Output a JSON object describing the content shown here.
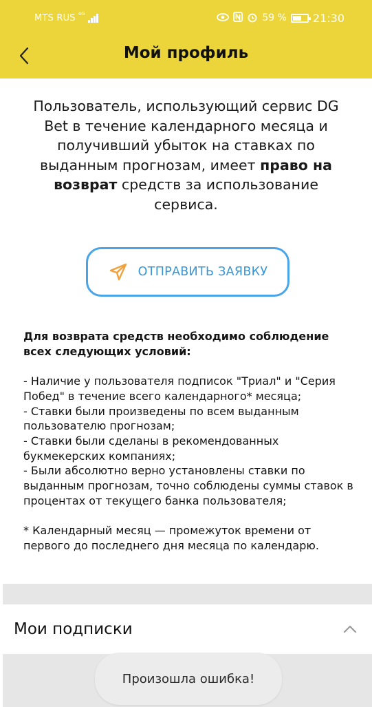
{
  "status_bar": {
    "carrier": "MTS RUS",
    "network_type": "4G",
    "battery_percent": "59 %",
    "time": "21:30",
    "icons": [
      "signal-icon",
      "eye-icon",
      "nfc-icon",
      "alarm-icon",
      "battery-icon"
    ]
  },
  "header": {
    "title": "Мой профиль",
    "back_icon": "chevron-left-icon",
    "background": "#ecd53a"
  },
  "intro": {
    "text_before": "Пользователь, использующий сервис DG Bet в течение календарного месяца и получивший убыток на ставках по выданным прогнозам, имеет ",
    "bold": "право на возврат",
    "text_after": " средств за использование сервиса."
  },
  "submit_button": {
    "label": "ОТПРАВИТЬ ЗАЯВКУ",
    "icon": "send-icon",
    "border_color": "#49a4e8",
    "icon_color": "#f0a03c"
  },
  "conditions": {
    "title": "Для возврата средств необходимо соблюдение всех следующих условий:",
    "items": [
      "- Наличие у пользователя подписок \"Триал\" и \"Серия Побед\" в течение всего календарного* месяца;",
      "- Ставки были произведены по всем выданным пользователю прогнозам;",
      "- Ставки были сделаны в рекомендованных букмекерских компаниях;",
      "- Были абсолютно верно установлены ставки по выданным прогнозам, точно соблюдены суммы ставок в процентах от текущего банка пользователя;"
    ],
    "footnote": "* Календарный месяц — промежуток времени от первого до последнего дня месяца по календарю."
  },
  "subscriptions": {
    "title": "Мои подписки",
    "icon": "chevron-up-icon"
  },
  "toast": {
    "text": "Произошла ошибка!"
  }
}
